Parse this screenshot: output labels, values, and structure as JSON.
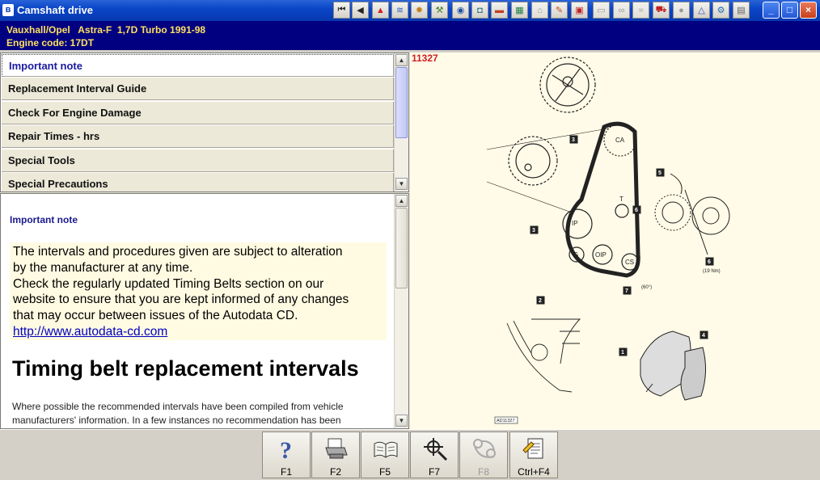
{
  "window": {
    "title": "Camshaft drive",
    "app_icon": "autodata-icon",
    "toolbar_icons": [
      "first-page-icon",
      "previous-icon",
      "warning-icon",
      "engine-data-icon",
      "service-icon",
      "tools-icon",
      "clock-icon",
      "camera-icon",
      "battery-icon",
      "ecu-icon",
      "lamp-icon",
      "pen-icon",
      "diagnostic-icon",
      "blank-icon",
      "belt-icon",
      "cable-icon",
      "car-icon",
      "disc-icon",
      "triangle-icon",
      "key-icon",
      "print-icon"
    ],
    "controls": {
      "minimize": "_",
      "maximize": "□",
      "close": "×"
    }
  },
  "vehicle": {
    "line1": "Vauxhall/Opel   Astra-F  1,7D Turbo 1991-98",
    "line2": "Engine code: 17DT"
  },
  "menu": {
    "items": [
      {
        "label": "Important note",
        "selected": true
      },
      {
        "label": "Replacement Interval Guide",
        "selected": false
      },
      {
        "label": "Check For Engine Damage",
        "selected": false
      },
      {
        "label": "Repair Times - hrs",
        "selected": false
      },
      {
        "label": "Special Tools",
        "selected": false
      },
      {
        "label": "Special Precautions",
        "selected": false
      }
    ]
  },
  "content": {
    "heading": "Important note",
    "note_line1": "The intervals and procedures given are subject to alteration",
    "note_line2": "by the manufacturer at any time.",
    "note_line3": "Check the regularly updated Timing Belts section on our",
    "note_line4": "website to ensure that you are kept informed of any changes",
    "note_line5": "that may occur between issues of the Autodata CD.",
    "link": "http://www.autodata-cd.com",
    "big_heading": "Timing belt replacement intervals",
    "paragraph": "Where possible the recommended intervals have been compiled from vehicle manufacturers' information. In a few instances no recommendation has been"
  },
  "diagram": {
    "id": "11327",
    "caption": "AD11327",
    "labels": {
      "ca": "CA",
      "ip": "IP",
      "oip": "OIP",
      "g": "G",
      "cs": "CS",
      "t": "T",
      "n1": "1",
      "n2": "2",
      "n3": "3",
      "n4": "4",
      "n5": "5",
      "n6": "6",
      "n7": "7",
      "n8": "8",
      "torque": "(19 Nm)",
      "angle": "(60°)"
    }
  },
  "function_keys": [
    {
      "label": "F1",
      "icon": "help-icon",
      "enabled": true
    },
    {
      "label": "F2",
      "icon": "print-icon",
      "enabled": true
    },
    {
      "label": "F5",
      "icon": "manual-book-icon",
      "enabled": true
    },
    {
      "label": "F7",
      "icon": "component-locator-icon",
      "enabled": true
    },
    {
      "label": "F8",
      "icon": "belt-route-icon",
      "enabled": false
    },
    {
      "label": "Ctrl+F4",
      "icon": "notes-icon",
      "enabled": true
    }
  ]
}
